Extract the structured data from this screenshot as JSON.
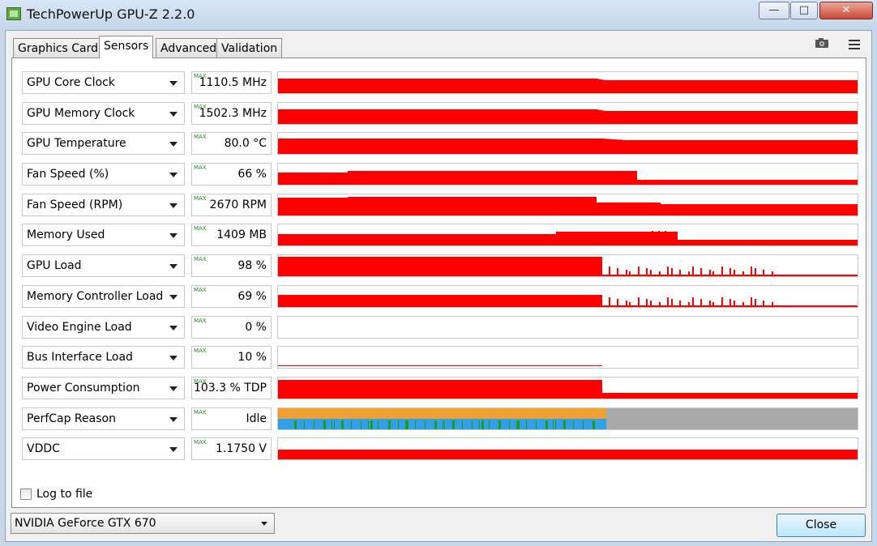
{
  "window": {
    "title": "TechPowerUp GPU-Z 2.2.0",
    "close_glyph": "✕",
    "minimize_glyph": "—",
    "maximize_glyph": "□"
  },
  "tabs": [
    {
      "label": "Graphics Card"
    },
    {
      "label": "Sensors",
      "active": true
    },
    {
      "label": "Advanced"
    },
    {
      "label": "Validation"
    }
  ],
  "toolbar": {
    "screenshot_icon": "camera-icon",
    "menu_icon": "hamburger-menu-icon"
  },
  "max_badge": "MAX",
  "sensors": [
    {
      "name": "GPU Core Clock",
      "value": "1110.5 MHz"
    },
    {
      "name": "GPU Memory Clock",
      "value": "1502.3 MHz"
    },
    {
      "name": "GPU Temperature",
      "value": "80.0 °C"
    },
    {
      "name": "Fan Speed (%)",
      "value": "66 %"
    },
    {
      "name": "Fan Speed (RPM)",
      "value": "2670 RPM"
    },
    {
      "name": "Memory Used",
      "value": "1409 MB"
    },
    {
      "name": "GPU Load",
      "value": "98 %"
    },
    {
      "name": "Memory Controller Load",
      "value": "69 %"
    },
    {
      "name": "Video Engine Load",
      "value": "0 %"
    },
    {
      "name": "Bus Interface Load",
      "value": "10 %"
    },
    {
      "name": "Power Consumption",
      "value": "103.3 % TDP"
    },
    {
      "name": "PerfCap Reason",
      "value": "Idle"
    },
    {
      "name": "VDDC",
      "value": "1.1750 V"
    }
  ],
  "colors": {
    "graph_line": "#ff0000",
    "perfcap_orange": "#f0a030",
    "perfcap_blue": "#30a0e8",
    "perfcap_green": "#1e9a1e",
    "perfcap_idle": "#a8a8a8"
  },
  "log_to_file": {
    "label": "Log to file",
    "checked": false
  },
  "gpu_select": {
    "value": "NVIDIA GeForce GTX 670"
  },
  "close_button": {
    "label": "Close"
  }
}
